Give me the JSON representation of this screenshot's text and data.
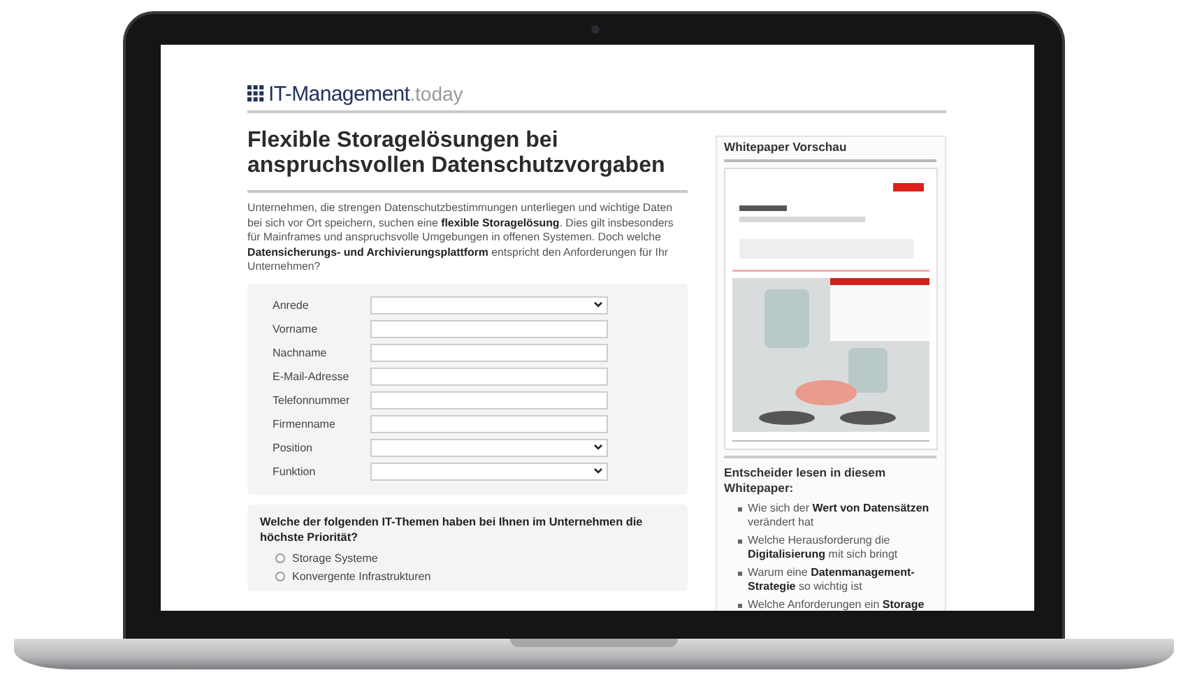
{
  "logo": {
    "main": "IT-Management",
    "suffix": ".today"
  },
  "article": {
    "title": "Flexible Storagelösungen bei anspruchsvollen Datenschutzvorgaben",
    "intro": "Unternehmen, die strengen Datenschutzbestimmungen unterliegen und wichtige Daten bei sich vor Ort speichern, suchen eine **flexible Storagelösung**. Dies gilt insbesonders für Mainframes und anspruchsvolle Umgebungen in offenen Systemen. Doch welche **Datensicherungs- und Archivierungsplattform** entspricht den Anforderungen für Ihr Unternehmen?"
  },
  "form": {
    "fields": [
      {
        "label": "Anrede",
        "kind": "select"
      },
      {
        "label": "Vorname",
        "kind": "text"
      },
      {
        "label": "Nachname",
        "kind": "text"
      },
      {
        "label": "E-Mail-Adresse",
        "kind": "text"
      },
      {
        "label": "Telefonnummer",
        "kind": "text"
      },
      {
        "label": "Firmenname",
        "kind": "text"
      },
      {
        "label": "Position",
        "kind": "select"
      },
      {
        "label": "Funktion",
        "kind": "select"
      }
    ]
  },
  "question": {
    "text": "Welche der folgenden IT-Themen haben bei Ihnen im Unternehmen die höchste Priorität?",
    "options": [
      {
        "label": "Storage Systeme",
        "selected": false
      },
      {
        "label": "Konvergente Infrastrukturen",
        "selected": false
      }
    ]
  },
  "sidebar": {
    "title": "Whitepaper Vorschau",
    "subtitle": "Entscheider lesen in diesem Whitepaper:",
    "bullets": [
      "Wie sich der **Wert von Datensätzen** verändert hat",
      "Welche Herausforderung die **Digitalisierung** mit sich bringt",
      "Warum eine **Datenmanagement-Strategie** so wichtig ist",
      "Welche Anforderungen ein **Storage**"
    ]
  }
}
